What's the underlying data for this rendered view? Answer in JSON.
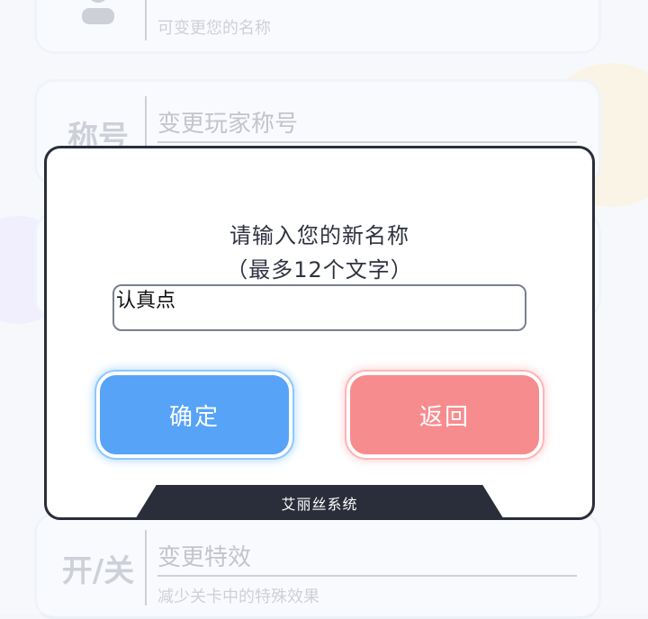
{
  "background_settings": [
    {
      "title": "",
      "subtitle": "可变更您的名称",
      "icon": "user-icon"
    },
    {
      "title": "变更玩家称号",
      "subtitle": "",
      "icon": "title-badge-icon",
      "icon_text": "称号"
    },
    {
      "title": "",
      "subtitle": "",
      "icon": "music-note-icon"
    },
    {
      "title": "变更特效",
      "subtitle": "减少关卡中的特殊效果",
      "icon": "effect-toggle-icon",
      "icon_text": "开/关"
    }
  ],
  "modal": {
    "prompt_line1": "请输入您的新名称",
    "prompt_line2": "（最多12个文字）",
    "input_value": "认真点",
    "confirm_label": "确定",
    "back_label": "返回",
    "footer": "艾丽丝系统"
  },
  "colors": {
    "confirm": "#57a3f7",
    "back": "#f78c8e",
    "frame": "#2a2d3a"
  }
}
